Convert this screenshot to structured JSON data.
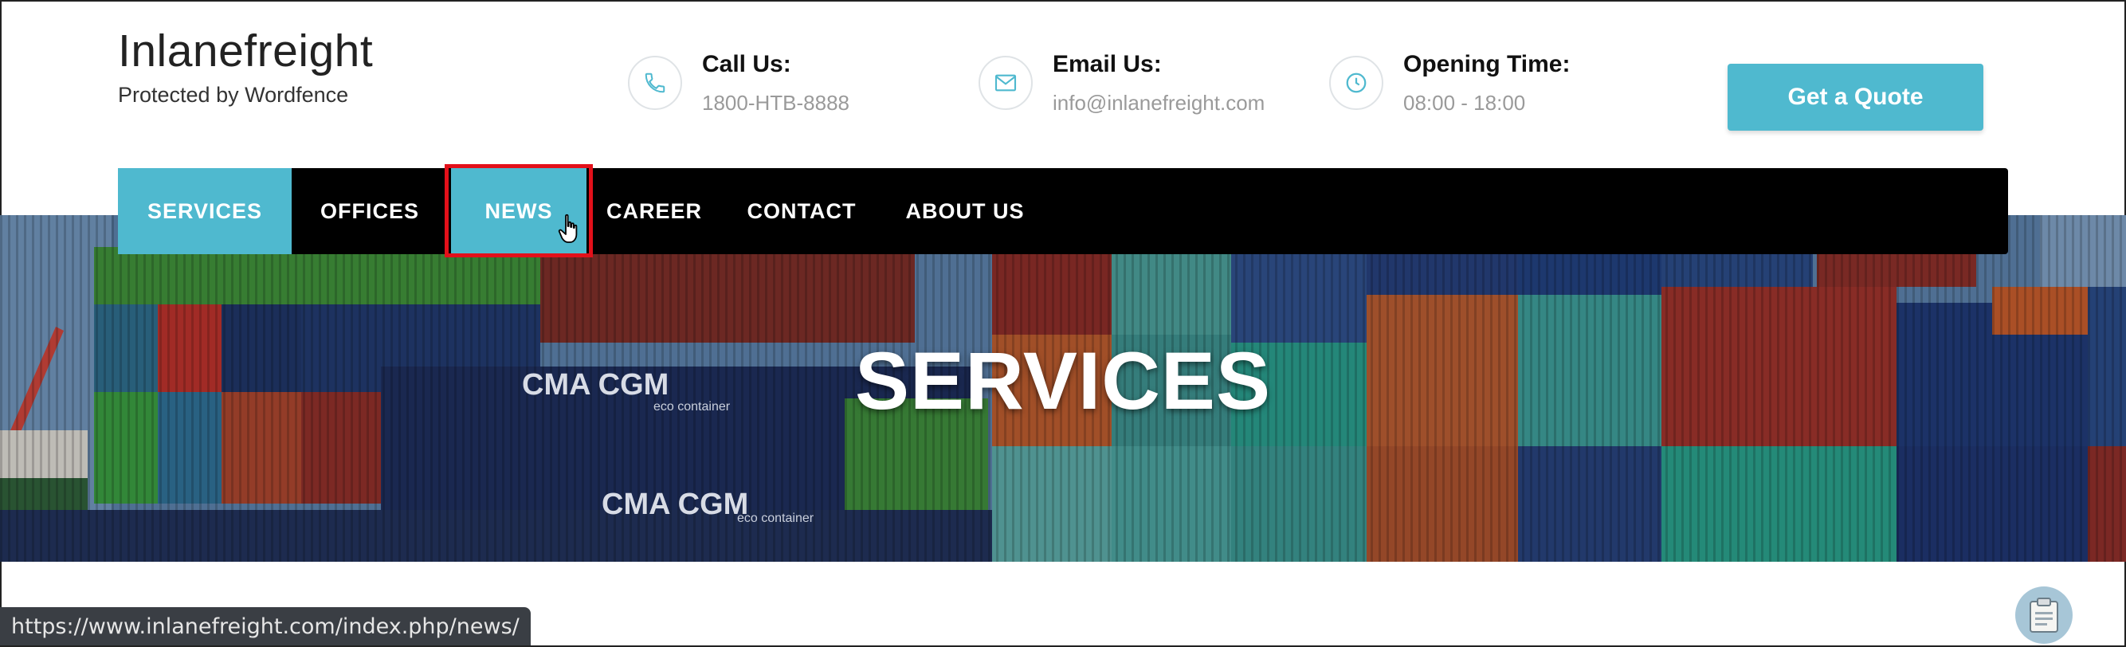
{
  "brand": {
    "title": "Inlanefreight",
    "tagline": "Protected by Wordfence"
  },
  "contact": [
    {
      "icon": "phone-icon",
      "label": "Call Us:",
      "value": "1800-HTB-8888"
    },
    {
      "icon": "envelope-icon",
      "label": "Email Us:",
      "value": "info@inlanefreight.com"
    },
    {
      "icon": "clock-icon",
      "label": "Opening Time:",
      "value": "08:00 - 18:00"
    }
  ],
  "quote_button": "Get a Quote",
  "nav": {
    "items": [
      "SERVICES",
      "OFFICES",
      "NEWS",
      "CAREER",
      "CONTACT",
      "ABOUT US"
    ],
    "active": "SERVICES",
    "hovered": "NEWS"
  },
  "hero": {
    "title": "SERVICES"
  },
  "container_text": {
    "brand_a": "CMA CGM",
    "sub_a": "eco container",
    "brand_b": "CMA CGM",
    "sub_b": "eco container"
  },
  "status_url": "https://www.inlanefreight.com/index.php/news/",
  "colors": {
    "accent": "#4fb9cf",
    "nav_bg": "#000000",
    "highlight": "#e3101a"
  }
}
